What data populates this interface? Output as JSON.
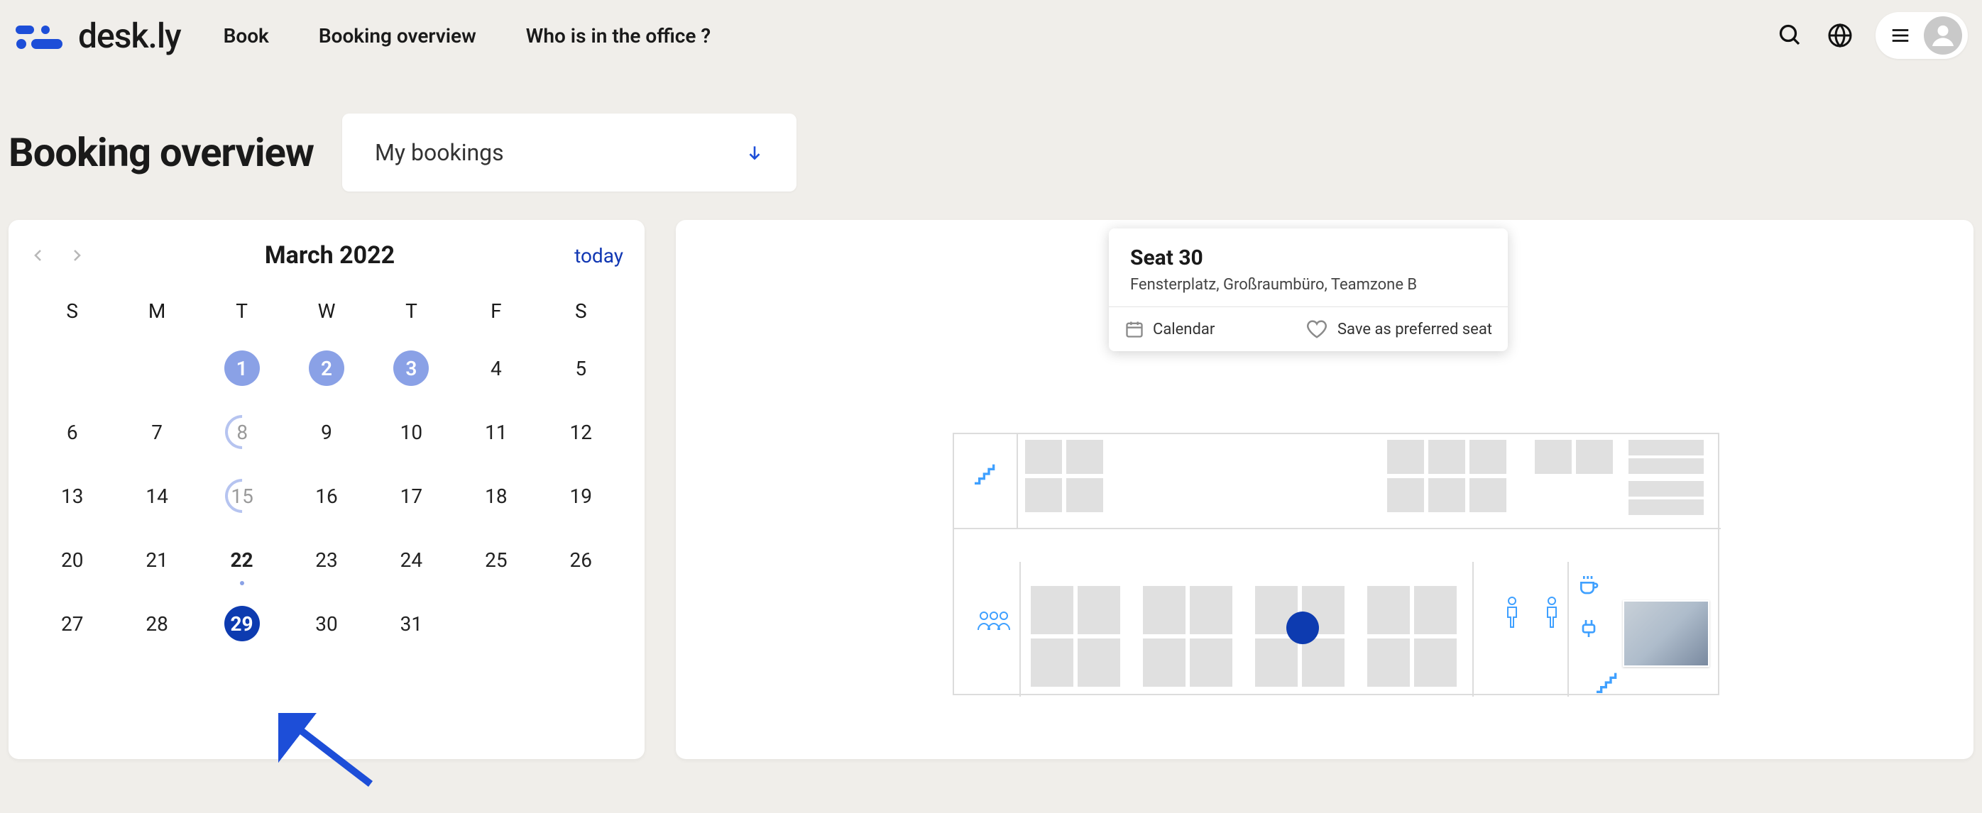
{
  "brand": "desk.ly",
  "nav": {
    "book": "Book",
    "overview": "Booking overview",
    "who": "Who is in the office ?"
  },
  "page_title": "Booking overview",
  "dropdown": {
    "label": "My bookings"
  },
  "calendar": {
    "month_label": "March 2022",
    "today_label": "today",
    "dow": [
      "S",
      "M",
      "T",
      "W",
      "T",
      "F",
      "S"
    ],
    "weeks": [
      [
        {
          "n": "",
          "type": "blank"
        },
        {
          "n": "",
          "type": "blank"
        },
        {
          "n": "1",
          "type": "light"
        },
        {
          "n": "2",
          "type": "light"
        },
        {
          "n": "3",
          "type": "light"
        },
        {
          "n": "4",
          "type": "plain"
        },
        {
          "n": "5",
          "type": "plain"
        }
      ],
      [
        {
          "n": "6",
          "type": "plain"
        },
        {
          "n": "7",
          "type": "plain"
        },
        {
          "n": "8",
          "type": "ring"
        },
        {
          "n": "9",
          "type": "plain"
        },
        {
          "n": "10",
          "type": "plain"
        },
        {
          "n": "11",
          "type": "plain"
        },
        {
          "n": "12",
          "type": "plain"
        }
      ],
      [
        {
          "n": "13",
          "type": "plain"
        },
        {
          "n": "14",
          "type": "plain"
        },
        {
          "n": "15",
          "type": "ring"
        },
        {
          "n": "16",
          "type": "plain"
        },
        {
          "n": "17",
          "type": "plain"
        },
        {
          "n": "18",
          "type": "plain"
        },
        {
          "n": "19",
          "type": "plain"
        }
      ],
      [
        {
          "n": "20",
          "type": "plain"
        },
        {
          "n": "21",
          "type": "plain"
        },
        {
          "n": "22",
          "type": "bold",
          "today": true
        },
        {
          "n": "23",
          "type": "plain"
        },
        {
          "n": "24",
          "type": "plain"
        },
        {
          "n": "25",
          "type": "plain"
        },
        {
          "n": "26",
          "type": "plain"
        }
      ],
      [
        {
          "n": "27",
          "type": "plain"
        },
        {
          "n": "28",
          "type": "plain"
        },
        {
          "n": "29",
          "type": "dark"
        },
        {
          "n": "30",
          "type": "plain"
        },
        {
          "n": "31",
          "type": "plain"
        },
        {
          "n": "",
          "type": "blank"
        },
        {
          "n": "",
          "type": "blank"
        }
      ]
    ]
  },
  "popover": {
    "title": "Seat 30",
    "subtitle": "Fensterplatz, Großraumbüro, Teamzone B",
    "calendar_action": "Calendar",
    "save_action": "Save as preferred seat"
  }
}
